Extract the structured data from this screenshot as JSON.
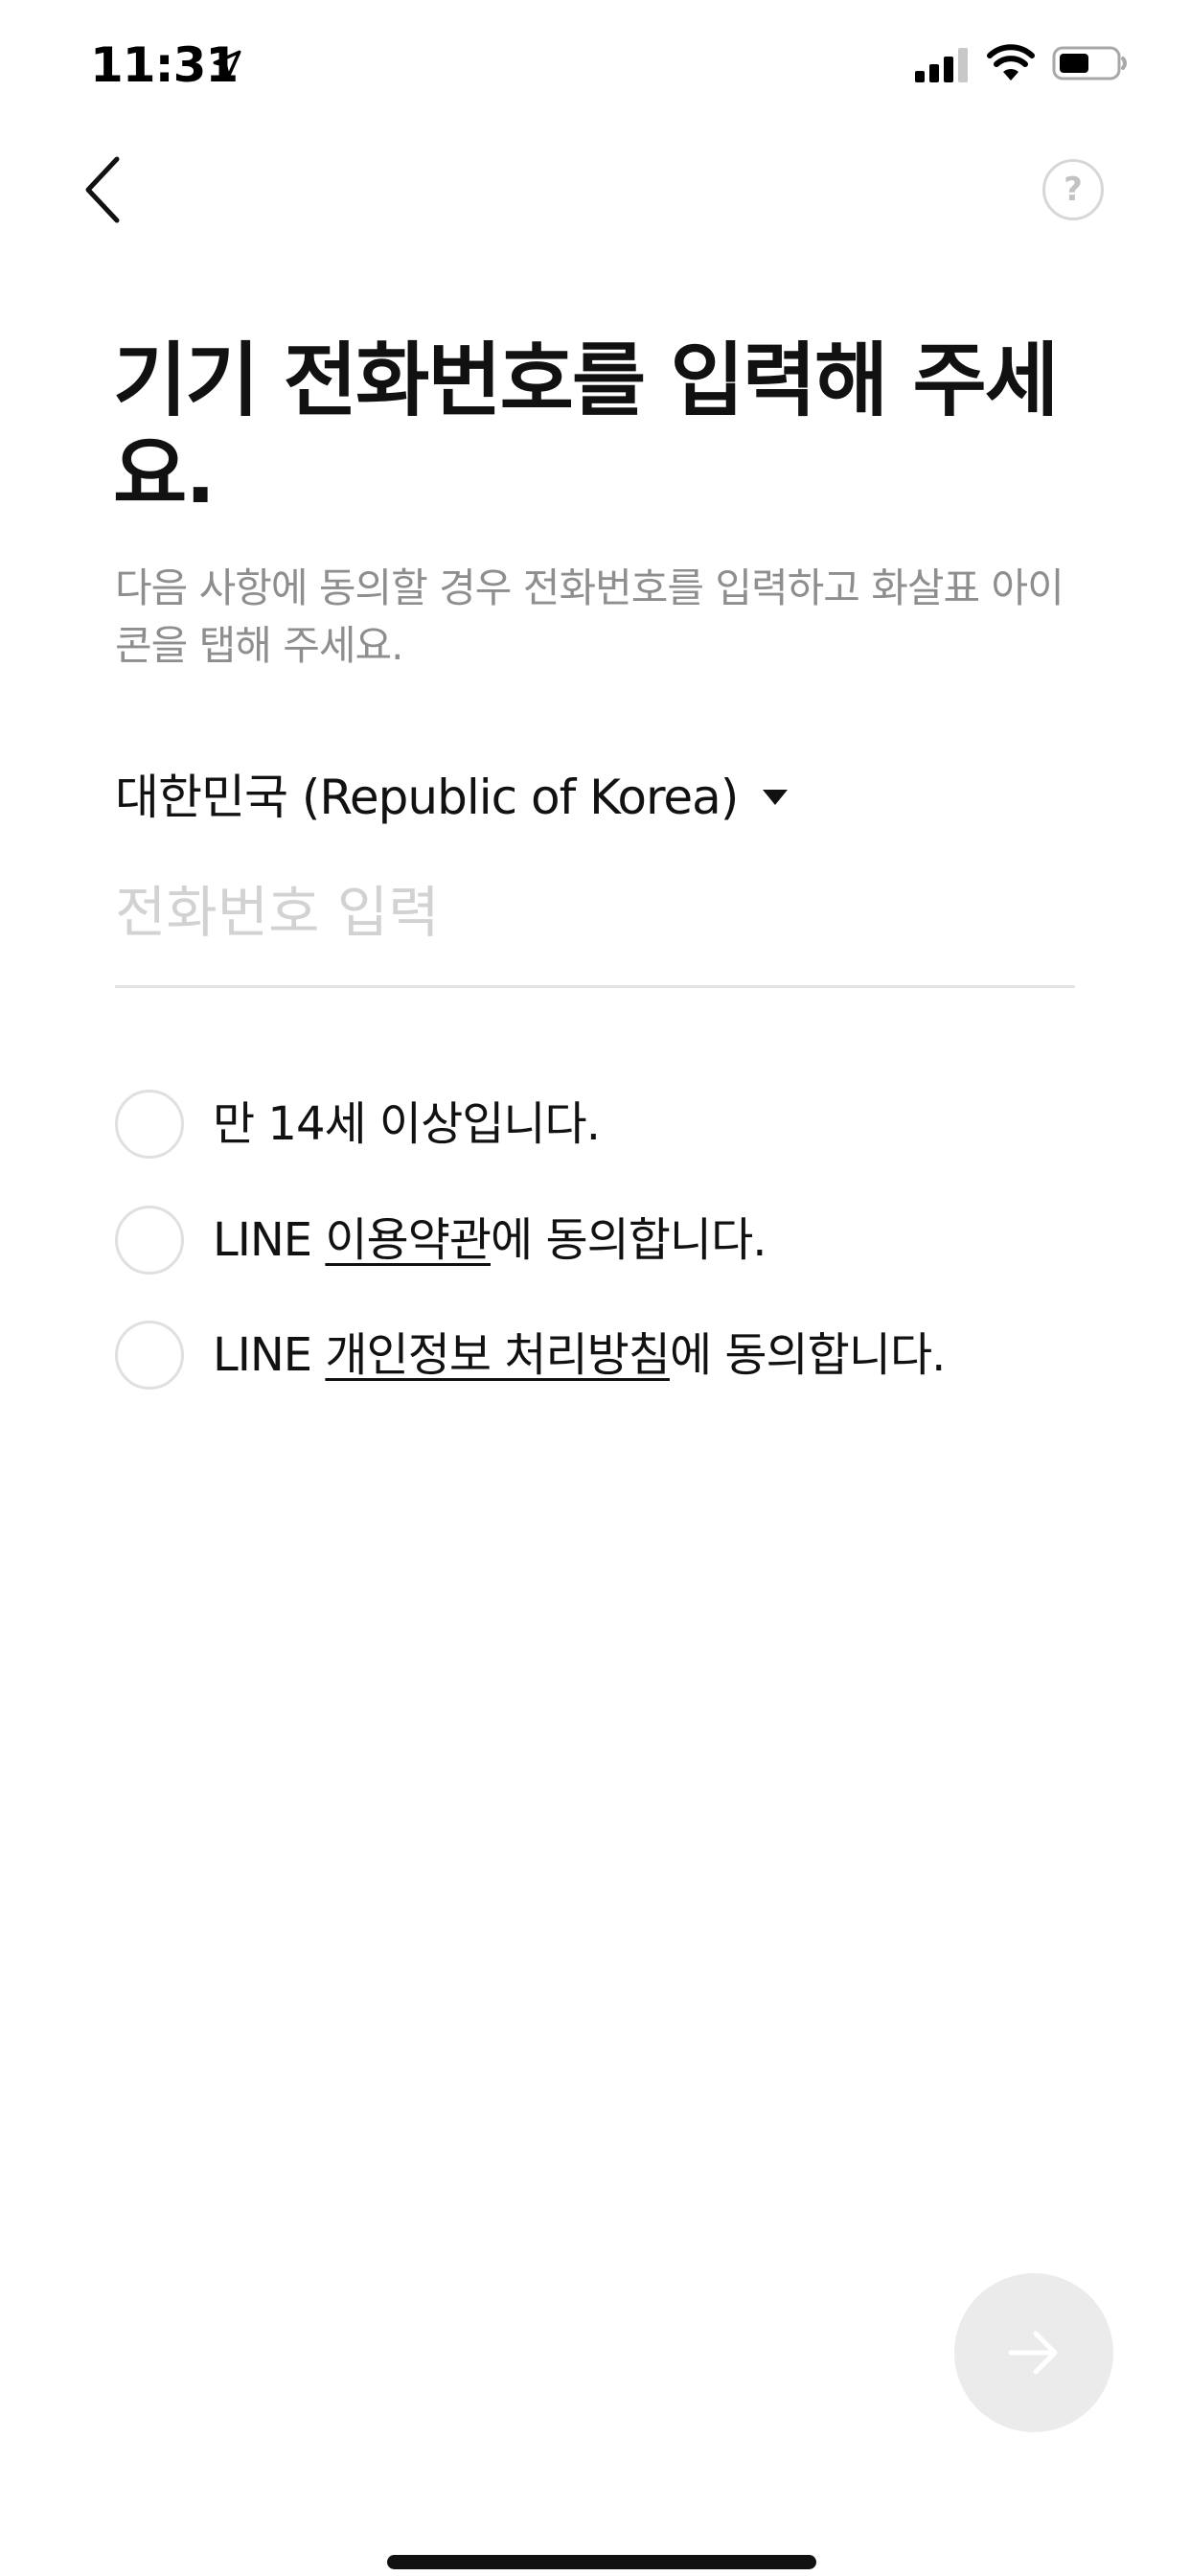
{
  "status_bar": {
    "time": "11:31",
    "icons": [
      "location-arrow-icon",
      "cellular-signal-icon",
      "wifi-icon",
      "battery-icon"
    ]
  },
  "nav": {
    "back_icon": "chevron-left-icon",
    "help_label": "?"
  },
  "title": "기기 전화번호를 입력해 주세요.",
  "subtitle": "다음 사항에 동의할 경우 전화번호를 입력하고 화살표 아이콘을 탭해 주세요.",
  "country": {
    "selected": "대한민국 (Republic of Korea)",
    "icon": "caret-down-icon"
  },
  "phone": {
    "value": "",
    "placeholder": "전화번호 입력"
  },
  "consents": [
    {
      "prefix": "만 14세 이상입니다.",
      "link": "",
      "suffix": "",
      "checked": false
    },
    {
      "prefix": "LINE ",
      "link": "이용약관",
      "suffix": "에 동의합니다.",
      "checked": false
    },
    {
      "prefix": "LINE ",
      "link": "개인정보 처리방침",
      "suffix": "에 동의합니다.",
      "checked": false
    }
  ],
  "next_button": {
    "icon": "arrow-right-icon",
    "enabled": false
  },
  "colors": {
    "text_primary": "#111111",
    "text_secondary": "#8e8e8e",
    "placeholder": "#d2d2d2",
    "divider": "#e3e3e3",
    "radio_border": "#e0e0e0",
    "next_button_disabled": "#ebebeb"
  }
}
